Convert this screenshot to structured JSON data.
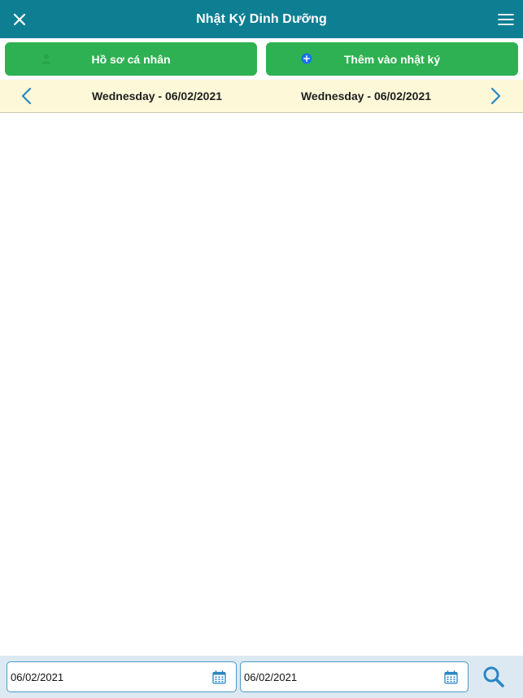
{
  "header": {
    "title": "Nhật Ký Dinh Dưỡng",
    "close_icon": "close-icon",
    "menu_icon": "hamburger-menu-icon"
  },
  "actions": {
    "profile_label": "Hồ sơ cá nhân",
    "profile_icon": "user-icon",
    "add_label": "Thêm vào nhật ký",
    "add_icon": "plus-circle-icon"
  },
  "date_nav": {
    "from_label": "Wednesday - 06/02/2021",
    "to_label": "Wednesday - 06/02/2021",
    "prev_icon": "chevron-left-icon",
    "next_icon": "chevron-right-icon"
  },
  "filter": {
    "from_value": "06/02/2021",
    "to_value": "06/02/2021",
    "calendar_icon": "calendar-icon",
    "search_icon": "search-icon"
  },
  "colors": {
    "header_bg": "#0e7f93",
    "button_green": "#2eb152",
    "date_bar_bg": "#fdf8d8",
    "accent_blue": "#2a86c4",
    "bottom_bar_bg": "#dce9f3"
  }
}
